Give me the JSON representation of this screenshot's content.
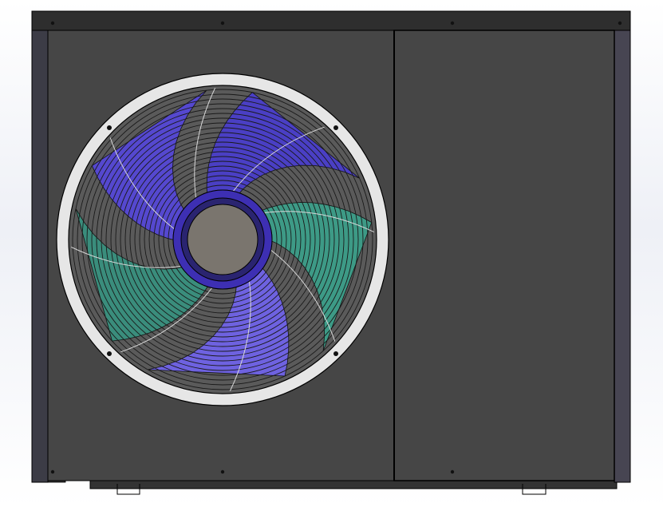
{
  "scene": {
    "background_top": "#ffffff",
    "background_mid": "#eef0f6"
  },
  "unit": {
    "panel_color": "#464646",
    "panel_edge_color": "#000000",
    "side_post_color": "#3c3c46",
    "right_post_color": "#474552",
    "top_cap_color": "#2e2e2e",
    "base_rail_color": "#333333"
  },
  "fan": {
    "ring_color": "#e6e6e6",
    "hub_color": "#7a756e",
    "hub_ring_color": "#3d2fb3",
    "blade_colors": [
      "#4a3fc4",
      "#3d9a86",
      "#6e62e0",
      "#3a8d7c",
      "#5548cf"
    ],
    "grille_color": "#1a1a1a",
    "blade_count": 5
  }
}
